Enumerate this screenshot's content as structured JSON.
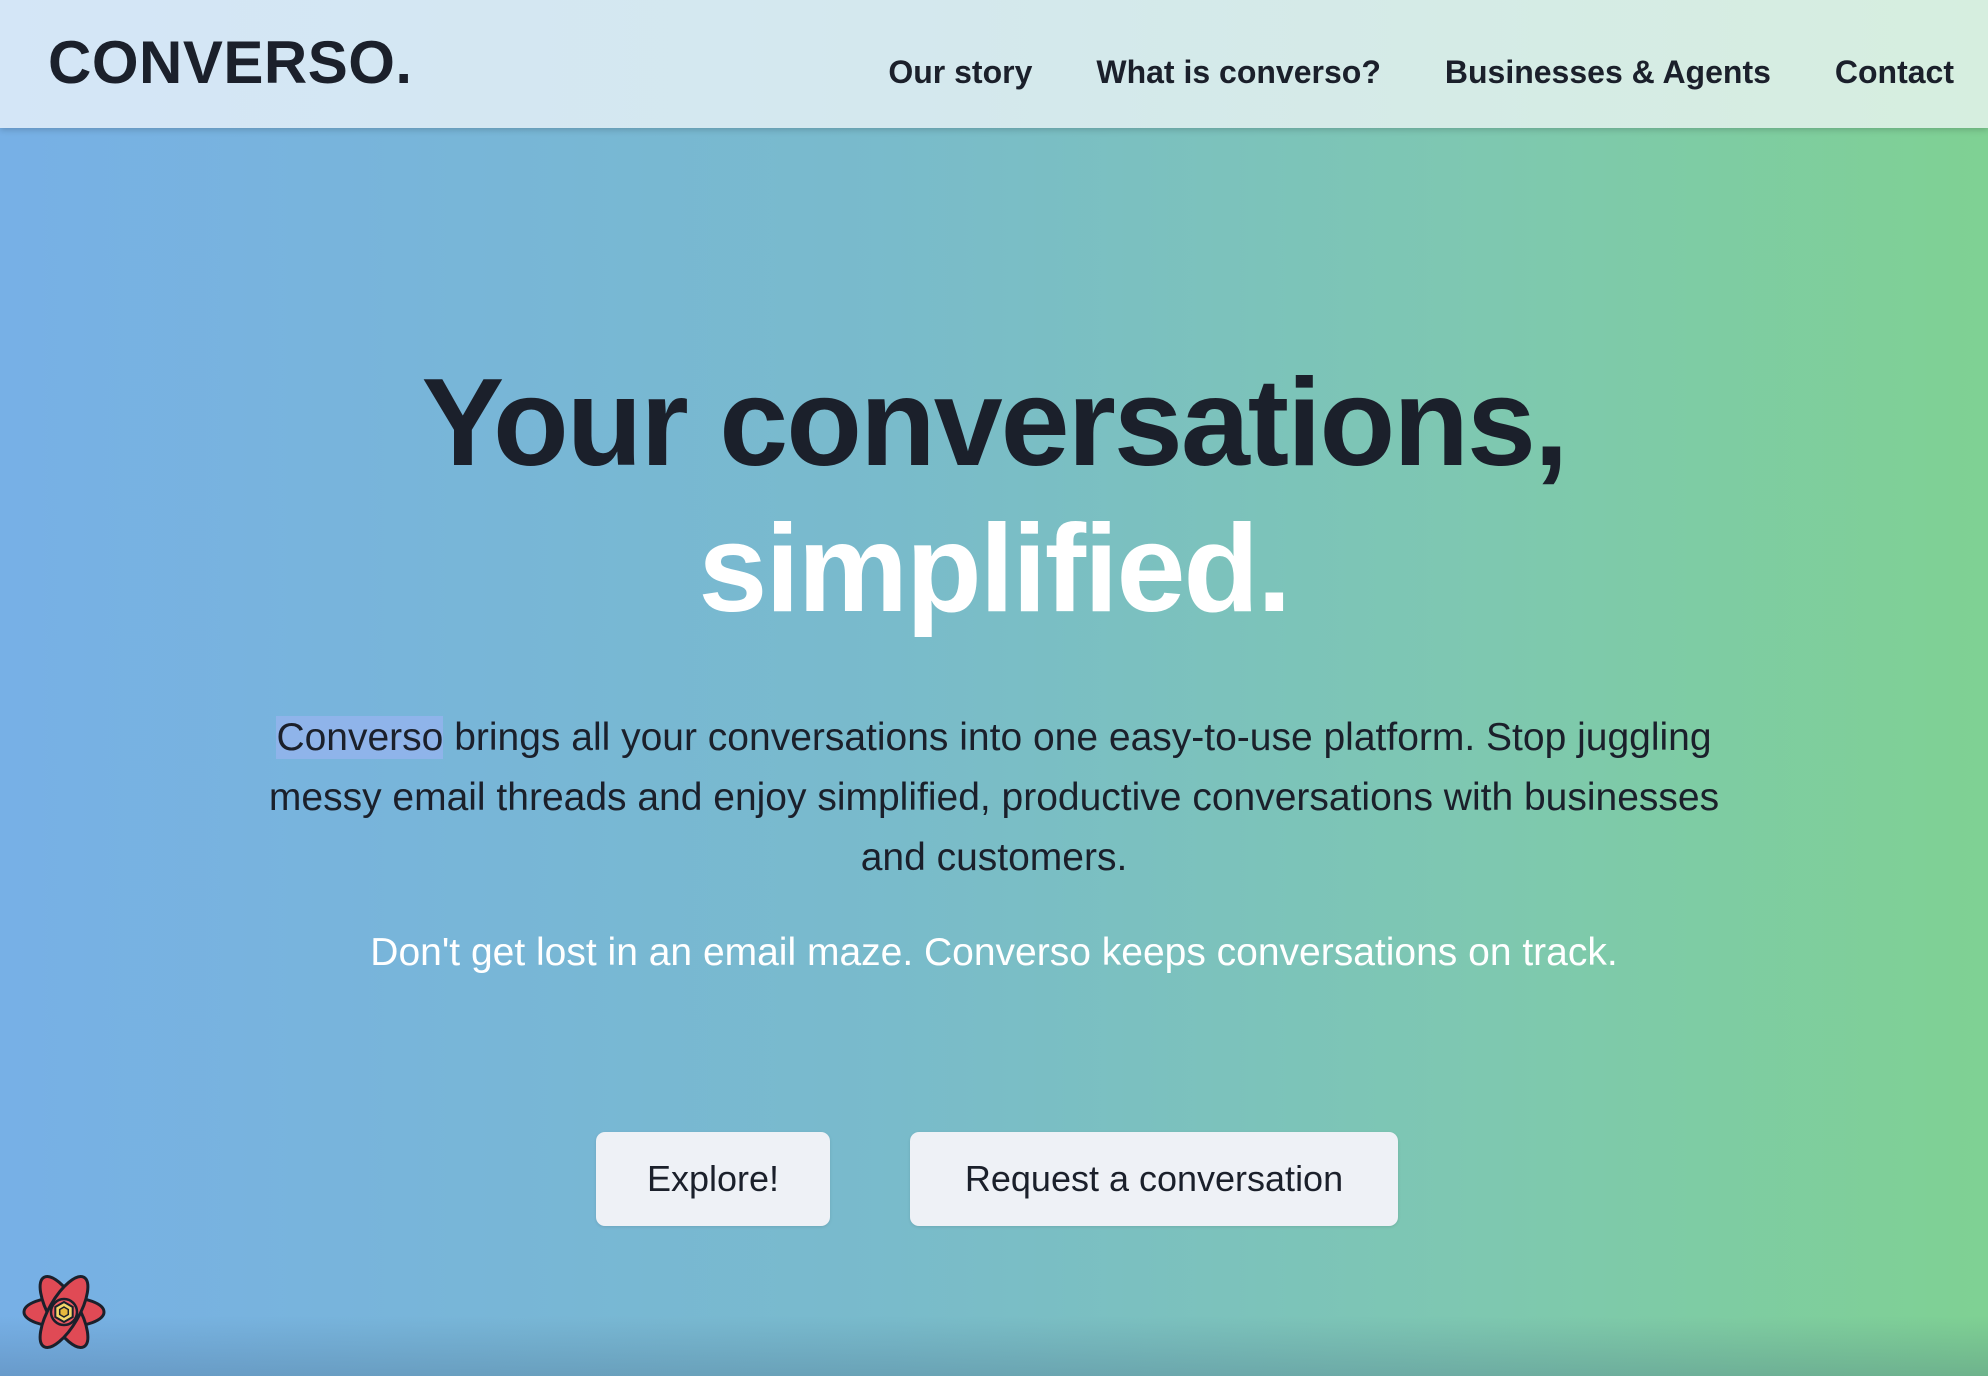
{
  "header": {
    "logo": "CONVERSO.",
    "nav": [
      {
        "label": "Our story"
      },
      {
        "label": "What is converso?"
      },
      {
        "label": "Businesses & Agents"
      },
      {
        "label": "Contact"
      }
    ]
  },
  "hero": {
    "headline_line1": "Your conversations,",
    "headline_line2": "simplified.",
    "intro_brand": "Converso",
    "intro_rest": " brings all your conversations into one easy-to-use platform. Stop juggling messy email threads and enjoy simplified, productive conversations with businesses and customers.",
    "tagline": "Don't get lost in an email maze. Converso keeps conversations on track.",
    "buttons": {
      "explore": "Explore!",
      "request": "Request a conversation"
    }
  },
  "devtools_badge": {
    "icon": "react-query-devtools-icon"
  },
  "colors": {
    "text_dark": "#1b202b",
    "text_light": "#ffffff",
    "gradient_left": "#77b0e6",
    "gradient_right": "#7fd193",
    "button_bg": "#eef1f6",
    "highlight": "#8fb4ea"
  }
}
